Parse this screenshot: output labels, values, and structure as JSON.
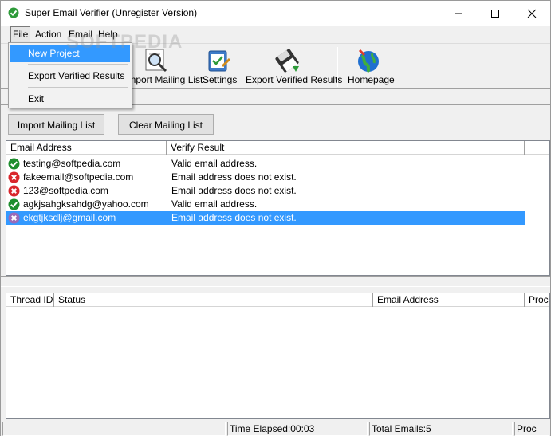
{
  "window": {
    "title": "Super Email Verifier (Unregister Version)",
    "watermark": "SOFTPEDIA"
  },
  "menu": {
    "items": [
      "File",
      "Action",
      "Email",
      "Help"
    ],
    "file_dropdown": [
      "New Project",
      "Export Verified Results",
      "Exit"
    ]
  },
  "toolbar": {
    "import_label": "Import Mailing List",
    "settings_label": "Settings",
    "export_label": "Export Verified Results",
    "homepage_label": "Homepage"
  },
  "buttons": {
    "import": "Import Mailing List",
    "clear": "Clear Mailing List"
  },
  "email_list": {
    "columns": [
      "Email Address",
      "Verify Result"
    ],
    "rows": [
      {
        "email": "testing@softpedia.com",
        "result": "Valid email address.",
        "status": "valid"
      },
      {
        "email": "fakeemail@softpedia.com",
        "result": "Email address does not exist.",
        "status": "invalid"
      },
      {
        "email": "123@softpedia.com",
        "result": "Email address does not exist.",
        "status": "invalid"
      },
      {
        "email": "agkjsahgksahdg@yahoo.com",
        "result": "Valid email address.",
        "status": "valid"
      },
      {
        "email": "ekgtjksdlj@gmail.com",
        "result": "Email address does not exist.",
        "status": "invalid"
      }
    ]
  },
  "thread_list": {
    "columns": [
      "Thread ID",
      "Status",
      "Email Address",
      "Proc"
    ]
  },
  "statusbar": {
    "time_elapsed": "Time Elapsed:00:03",
    "total_emails": "Total Emails:5",
    "proc": "Proc"
  },
  "colors": {
    "selection": "#3399ff",
    "valid": "#1e8e2e",
    "invalid": "#d9262c"
  }
}
